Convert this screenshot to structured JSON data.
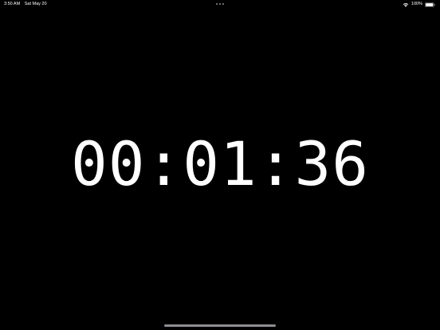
{
  "status_bar": {
    "time": "3:50 AM",
    "date": "Sat May 20",
    "battery_percent": "100%",
    "battery_level": 1.0,
    "icons": [
      "wifi-icon",
      "battery-icon"
    ]
  },
  "multitask_indicator": {
    "icon": "ellipsis-icon"
  },
  "timer": {
    "display": "00:01:36"
  },
  "colors": {
    "background": "#000000",
    "text": "#ffffff",
    "indicator": "#8e8e93"
  }
}
